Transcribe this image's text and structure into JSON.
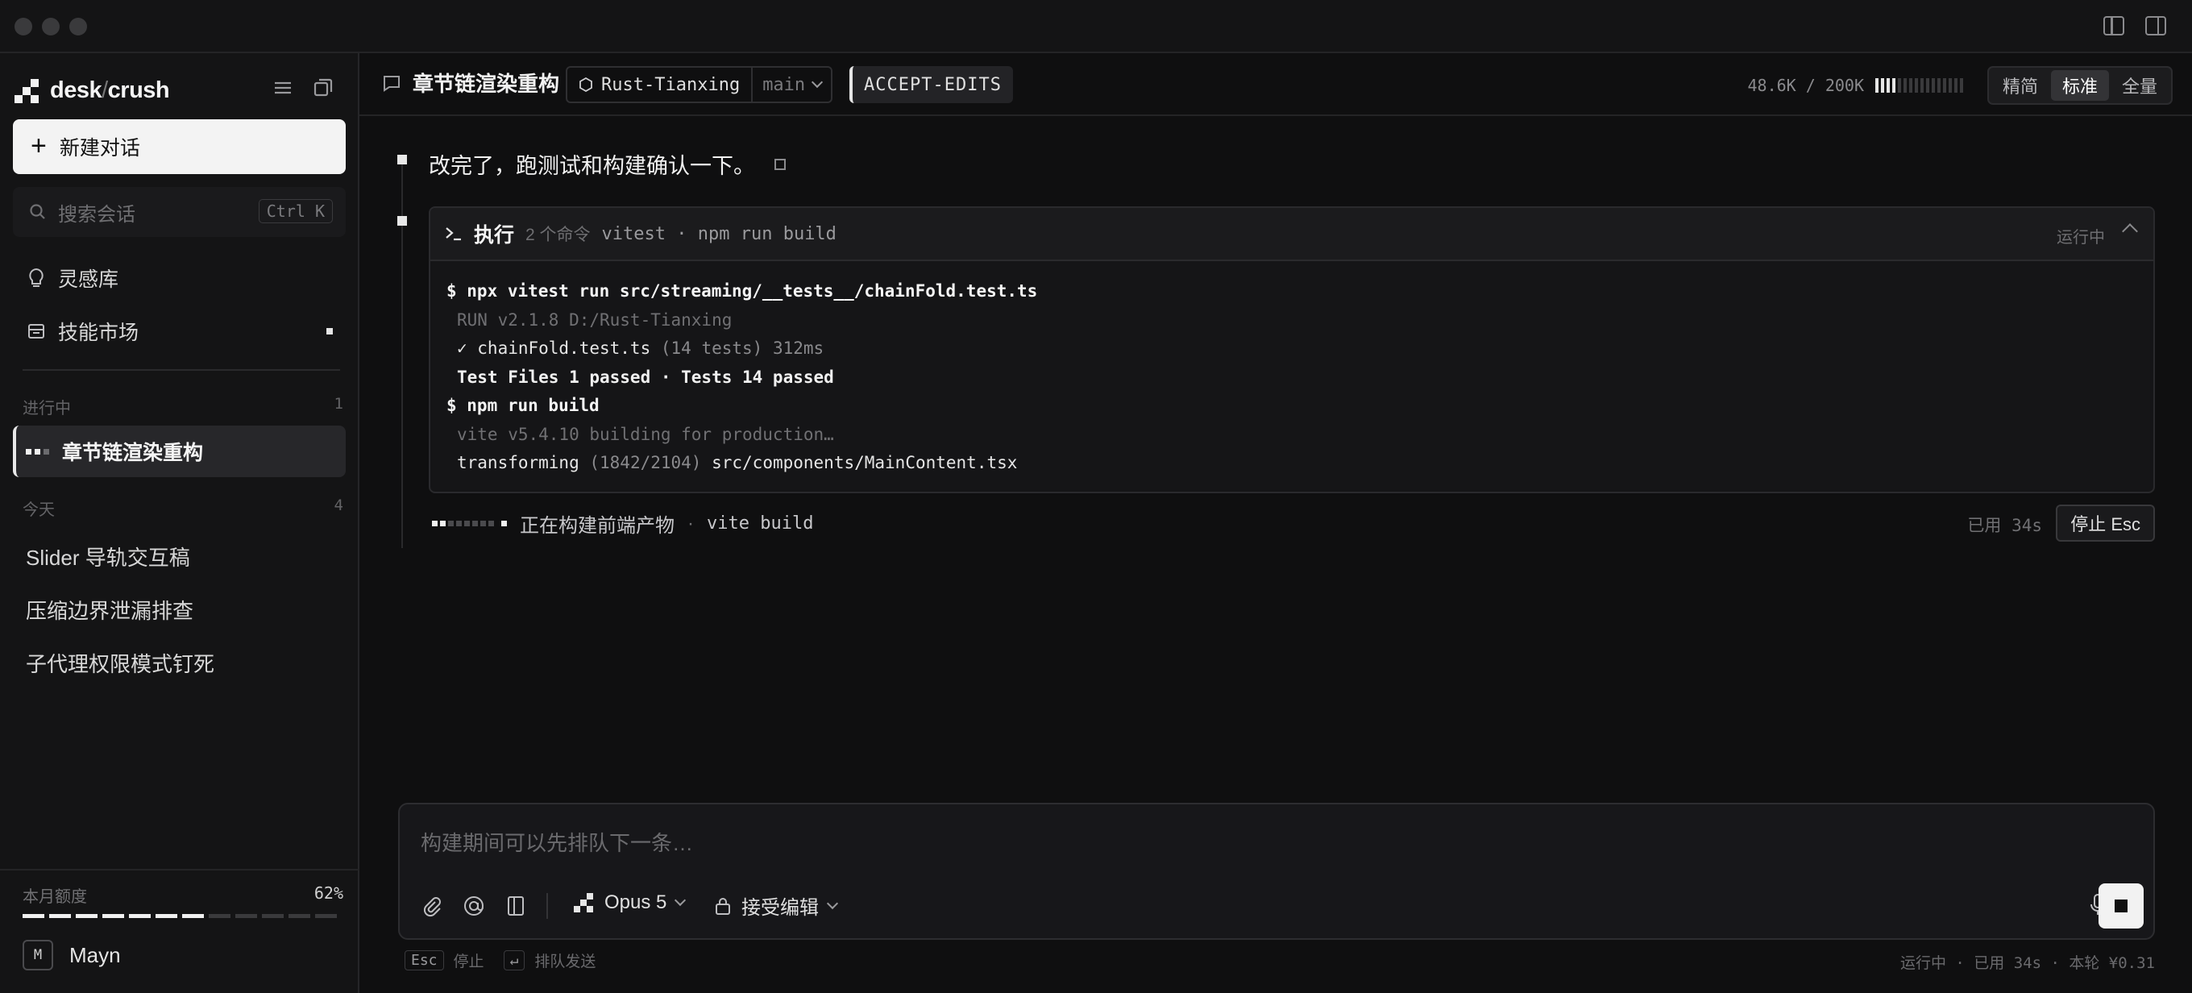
{
  "sidebar": {
    "logo_left": "desk",
    "logo_sep": "/",
    "logo_right": "crush",
    "new_chat": "新建对话",
    "search_placeholder": "搜索会话",
    "search_shortcut": "Ctrl K",
    "nav": [
      {
        "label": "灵感库",
        "icon": "lightbulb-icon"
      },
      {
        "label": "技能市场",
        "icon": "store-icon"
      }
    ],
    "in_progress": {
      "label": "进行中",
      "count": "1"
    },
    "active_conversation": "章节链渲染重构",
    "today": {
      "label": "今天",
      "count": "4"
    },
    "conversations": [
      "Slider 导轨交互稿",
      "压缩边界泄漏排查",
      "子代理权限模式钉死"
    ],
    "usage": {
      "label": "本月额度",
      "percent": "62%",
      "fraction": 0.62
    },
    "user": {
      "initial": "M",
      "name": "Mayn"
    }
  },
  "header": {
    "title": "章节链渲染重构",
    "repo": "Rust-Tianxing",
    "branch": "main",
    "mode": "ACCEPT-EDITS",
    "tokens": "48.6K / 200K",
    "token_fraction": 0.24,
    "views": [
      "精简",
      "标准",
      "全量"
    ],
    "selected_view": "标准"
  },
  "thread": {
    "user_message": "改完了，跑测试和构建确认一下。",
    "exec": {
      "title": "执行",
      "count": "2 个命令",
      "summary": "vitest · npm run build",
      "status": "运行中"
    },
    "terminal": {
      "cmd1": "$ npx vitest run src/streaming/__tests__/chainFold.test.ts",
      "run_line": "RUN  v2.1.8  D:/Rust-Tianxing",
      "test_file": "✓ chainFold.test.ts",
      "test_meta": "(14 tests) 312ms",
      "result": "Test Files 1 passed · Tests 14 passed",
      "cmd2": "$ npm run build",
      "vite_line": "vite v5.4.10 building for production…",
      "transform_label": "transforming",
      "transform_count": "(1842/2104)",
      "transform_file": "src/components/MainContent.tsx"
    },
    "progress": {
      "text": "正在构建前端产物",
      "sep": "·",
      "cmd": "vite build",
      "elapsed": "已用 34s",
      "stop": "停止 Esc"
    }
  },
  "composer": {
    "placeholder": "构建期间可以先排队下一条…",
    "model": "Opus 5",
    "permission": "接受编辑"
  },
  "footer": {
    "esc_key": "Esc",
    "esc_label": "停止",
    "enter_key": "↵",
    "enter_label": "排队发送",
    "status": "运行中 · 已用 34s · 本轮 ¥0.31"
  }
}
